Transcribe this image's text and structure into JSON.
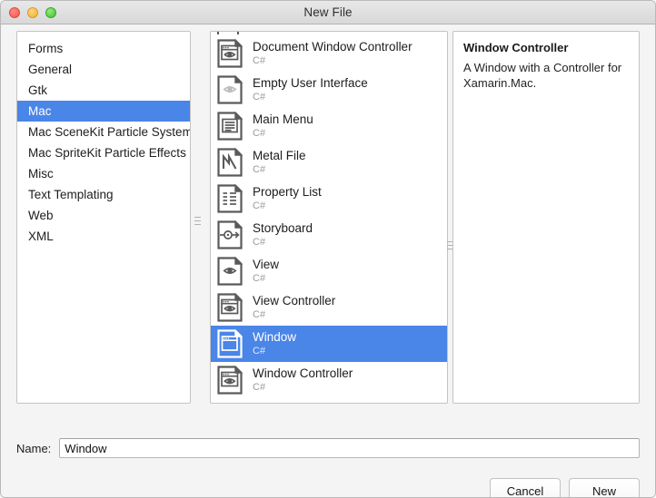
{
  "window": {
    "title": "New File",
    "traffic_lights": [
      {
        "name": "close-button",
        "color": "#f4544a"
      },
      {
        "name": "minimize-button",
        "color": "#f0b429"
      },
      {
        "name": "maximize-button",
        "color": "#38c231"
      }
    ]
  },
  "colors": {
    "selection_blue": "#4a85e8",
    "panel_background": "#ffffff",
    "window_background": "#f4f4f4",
    "icon_stroke": "#5a5a5a",
    "muted_text": "#9b9b9b"
  },
  "categories": {
    "selected_index": 3,
    "items": [
      {
        "label": "Forms"
      },
      {
        "label": "General"
      },
      {
        "label": "Gtk"
      },
      {
        "label": "Mac"
      },
      {
        "label": "Mac SceneKit Particle Systems"
      },
      {
        "label": "Mac SpriteKit Particle Effects"
      },
      {
        "label": "Misc"
      },
      {
        "label": "Text Templating"
      },
      {
        "label": "Web"
      },
      {
        "label": "XML"
      }
    ]
  },
  "templates": {
    "selected_index": 8,
    "items": [
      {
        "name": "Document Window Controller",
        "language": "C#",
        "icon": "document-window-controller-icon"
      },
      {
        "name": "Empty User Interface",
        "language": "C#",
        "icon": "empty-user-interface-icon"
      },
      {
        "name": "Main Menu",
        "language": "C#",
        "icon": "main-menu-icon"
      },
      {
        "name": "Metal File",
        "language": "C#",
        "icon": "metal-file-icon"
      },
      {
        "name": "Property List",
        "language": "C#",
        "icon": "property-list-icon"
      },
      {
        "name": "Storyboard",
        "language": "C#",
        "icon": "storyboard-icon"
      },
      {
        "name": "View",
        "language": "C#",
        "icon": "view-icon"
      },
      {
        "name": "View Controller",
        "language": "C#",
        "icon": "view-controller-icon"
      },
      {
        "name": "Window",
        "language": "C#",
        "icon": "window-icon"
      },
      {
        "name": "Window Controller",
        "language": "C#",
        "icon": "window-controller-icon"
      }
    ]
  },
  "details": {
    "title": "Window Controller",
    "description": "A Window with a Controller for Xamarin.Mac."
  },
  "name_field": {
    "label": "Name:",
    "value": "Window",
    "placeholder": ""
  },
  "buttons": {
    "cancel": "Cancel",
    "new": "New"
  }
}
